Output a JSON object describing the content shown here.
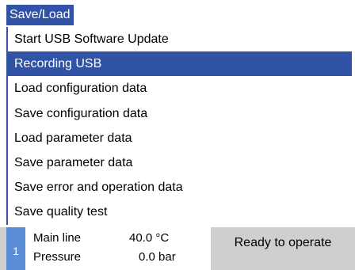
{
  "header": {
    "title": "Save/Load"
  },
  "menu": {
    "selected_index": 1,
    "items": [
      {
        "label": "Start USB Software Update"
      },
      {
        "label": "Recording USB"
      },
      {
        "label": "Load configuration data"
      },
      {
        "label": "Save configuration data"
      },
      {
        "label": "Load parameter data"
      },
      {
        "label": "Save parameter data"
      },
      {
        "label": "Save error and operation data"
      },
      {
        "label": "Save quality test"
      }
    ]
  },
  "status": {
    "index": "1",
    "line1": {
      "label": "Main line",
      "value": "40.0 °C"
    },
    "line2": {
      "label": "Pressure",
      "value": "0.0 bar"
    },
    "message": "Ready to operate"
  },
  "colors": {
    "accent": "#3053a5",
    "index_badge": "#5b8ed6",
    "status_bar": "#cfcfcf"
  }
}
